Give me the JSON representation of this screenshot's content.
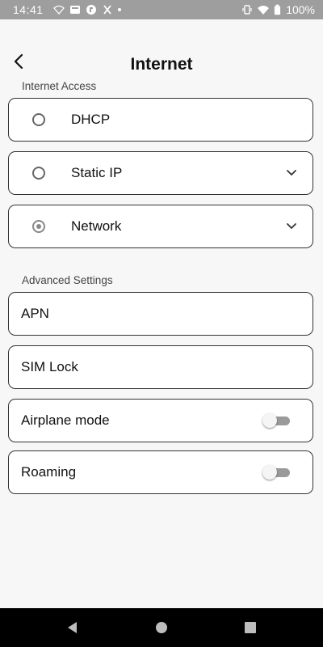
{
  "status_bar": {
    "time": "14:41",
    "battery": "100%",
    "left_icons": [
      "wifi-icon",
      "notification-icon",
      "app-icon",
      "tools-icon",
      "dot-icon"
    ],
    "right_icons": [
      "vibrate-icon",
      "wifi-signal-icon",
      "battery-icon"
    ]
  },
  "header": {
    "title": "Internet",
    "back_icon": "chevron-left-icon"
  },
  "internet_access": {
    "label": "Internet Access",
    "options": [
      {
        "label": "DHCP",
        "selected": false,
        "expandable": false
      },
      {
        "label": "Static IP",
        "selected": false,
        "expandable": true
      },
      {
        "label": "Network",
        "selected": true,
        "expandable": true
      }
    ]
  },
  "advanced": {
    "label": "Advanced Settings",
    "items": [
      {
        "label": "APN"
      },
      {
        "label": "SIM Lock"
      },
      {
        "label": "Airplane mode",
        "toggle": false
      },
      {
        "label": "Roaming",
        "toggle": false
      }
    ]
  },
  "navigation_bar": {
    "icons": [
      "back-triangle-icon",
      "home-circle-icon",
      "recents-square-icon"
    ]
  },
  "colors": {
    "status_bar": "#9e9e9e",
    "background": "#f7f7f7",
    "card_border": "#333333",
    "nav_bar": "#000000"
  }
}
